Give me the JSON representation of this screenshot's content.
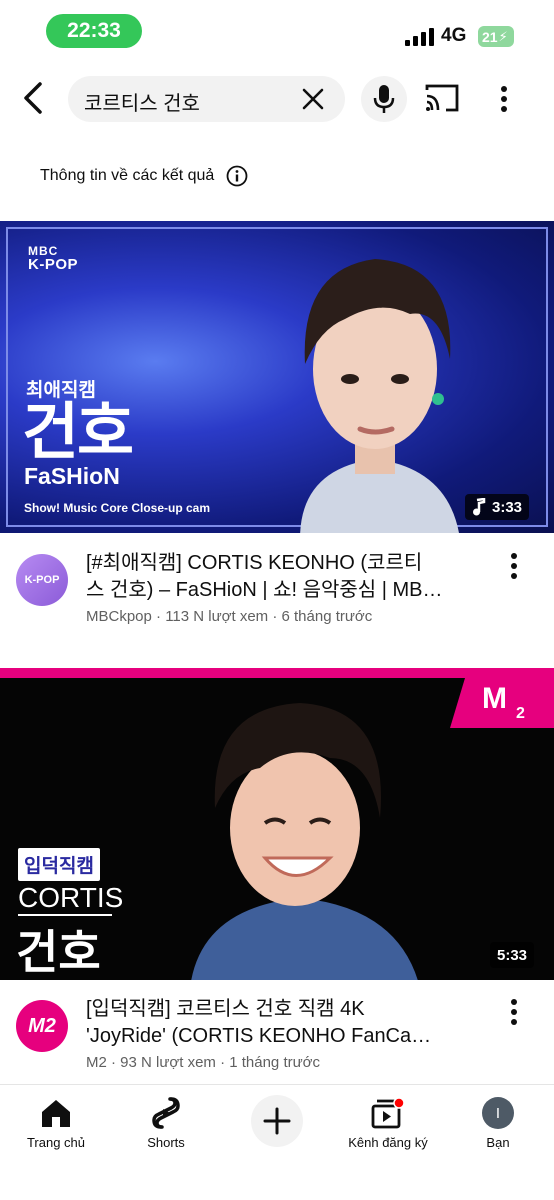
{
  "status_bar": {
    "time": "22:33",
    "network": "4G",
    "battery": "21"
  },
  "search": {
    "query": "코르티스 건호"
  },
  "info": {
    "text": "Thông tin về các kết quả"
  },
  "videos": [
    {
      "thumb": {
        "brand_top": "MBC",
        "brand_bottom": "K-POP",
        "tag": "최애직캠",
        "big": "건호",
        "song": "FaSHioN",
        "subtitle": "Show! Music Core Close-up cam"
      },
      "duration": "3:33",
      "avatar": "K-POP",
      "title_line1": "[#최애직캠] CORTIS KEONHO (코르티",
      "title_line2": "스 건호) – FaSHioN | 쇼! 음악중심 | MB…",
      "meta": "MBCkpop · 113 N lượt xem · 6 tháng trước"
    },
    {
      "thumb": {
        "tag": "입덕직캠",
        "group": "CORTIS",
        "big": "건호"
      },
      "duration": "5:33",
      "avatar": "M2",
      "title_line1": "[입덕직캠] 코르티스 건호 직캠 4K",
      "title_line2": "'JoyRide' (CORTIS KEONHO FanCa…",
      "meta": "M2 · 93 N lượt xem · 1 tháng trước"
    }
  ],
  "nav": {
    "home": "Trang chủ",
    "shorts": "Shorts",
    "subscriptions": "Kênh đăng ký",
    "you": "Bạn",
    "avatar_letter": "I"
  },
  "colors": {
    "time_pill": "#34c759",
    "m2_pink": "#e6007e",
    "mbc_blue": "#2b3bc8"
  }
}
